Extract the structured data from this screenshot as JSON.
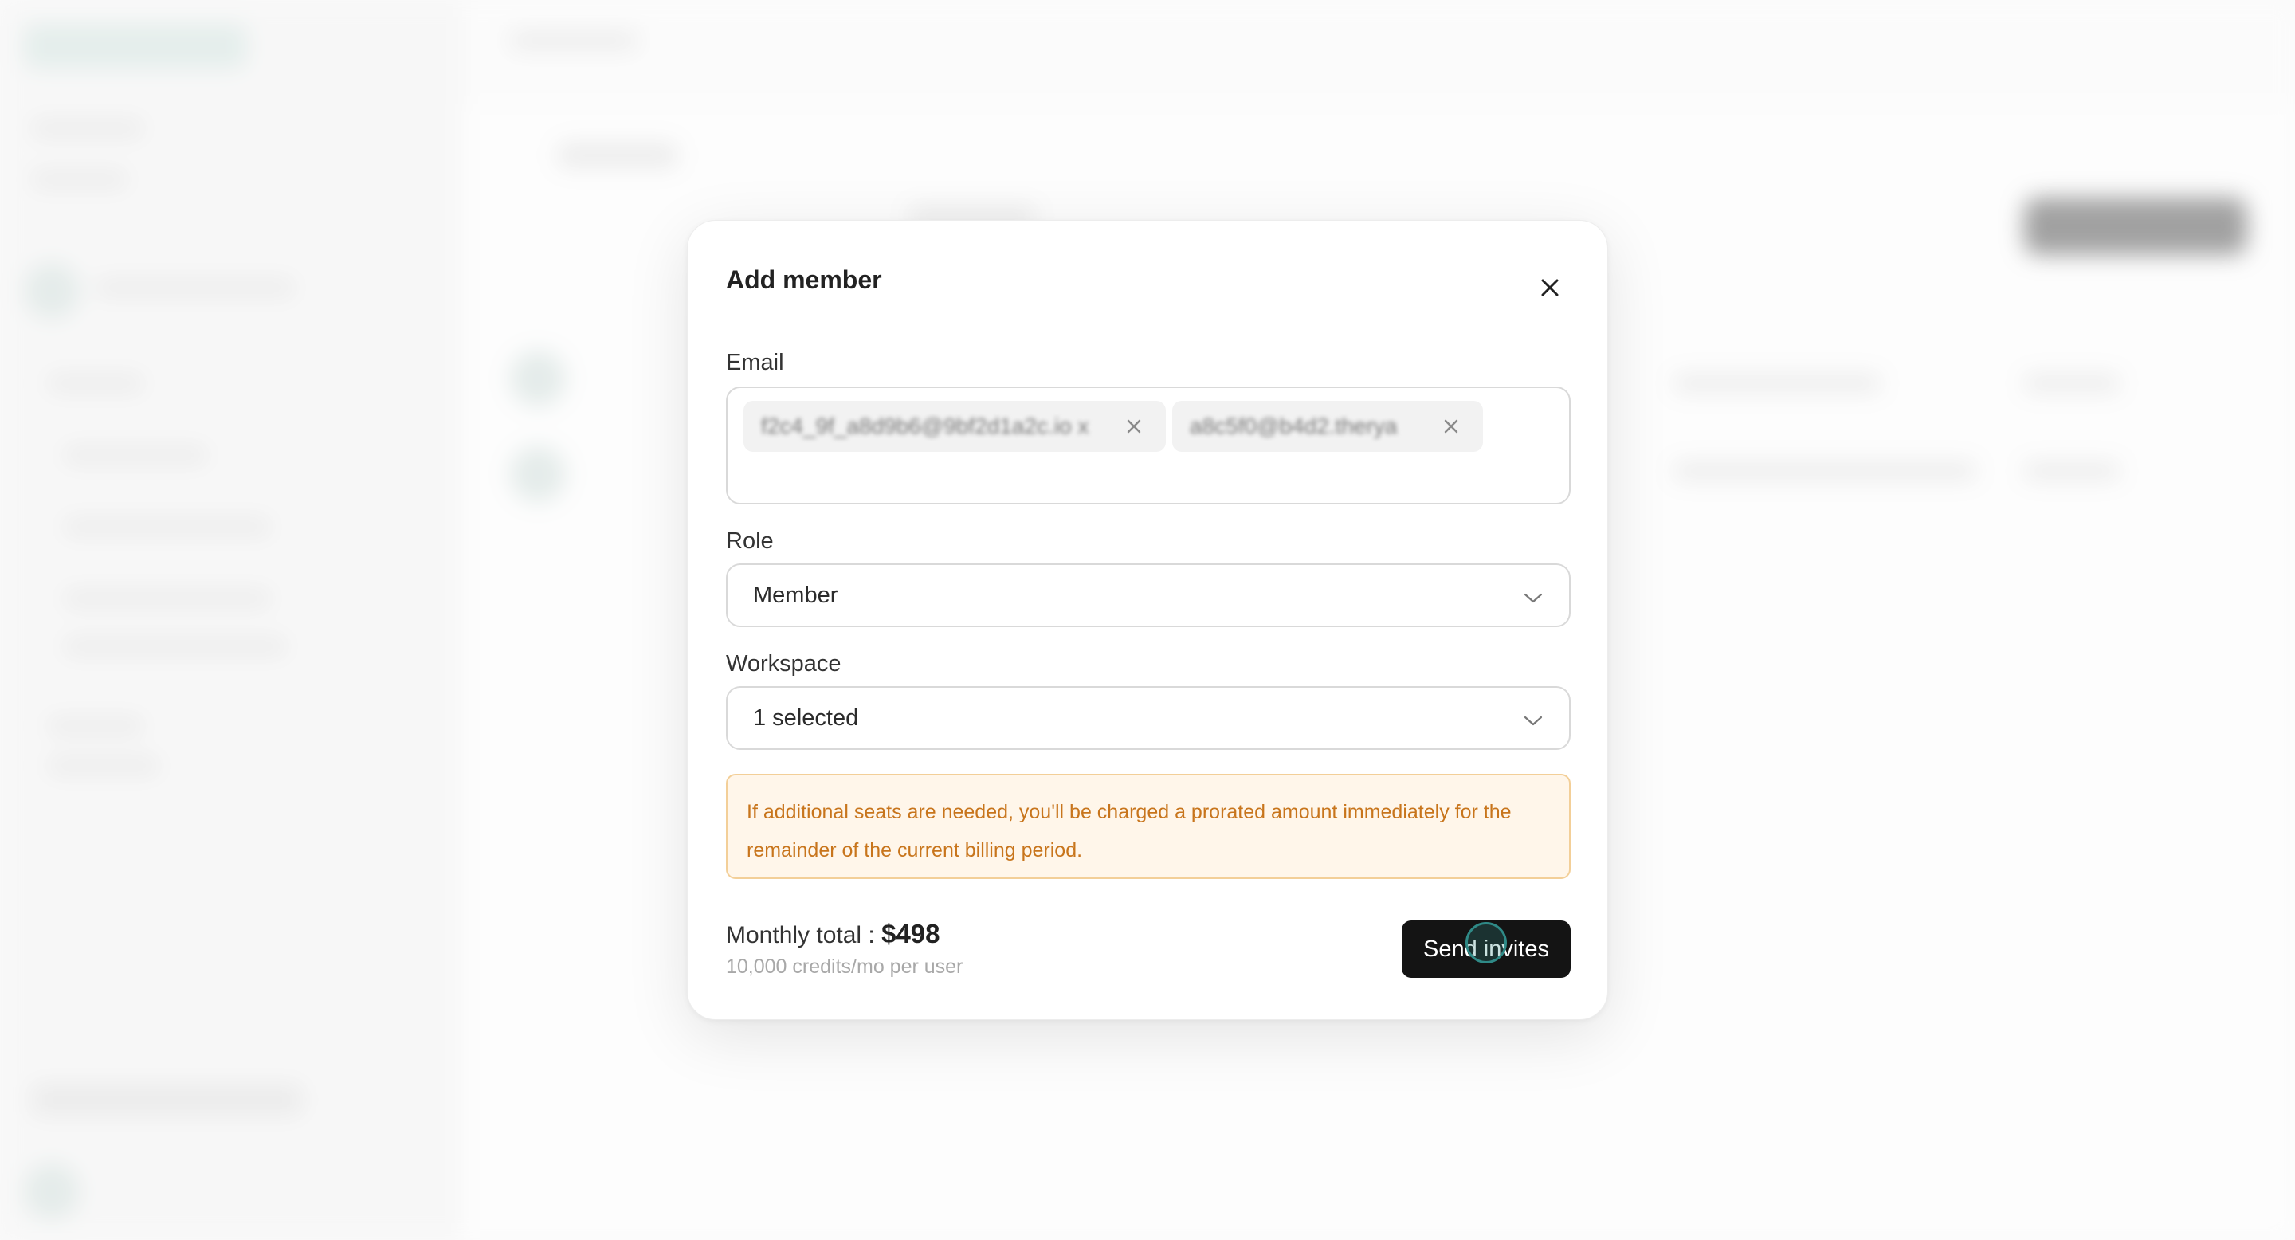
{
  "modal": {
    "title": "Add member",
    "close_icon": "close-icon"
  },
  "email": {
    "label": "Email",
    "chips": [
      {
        "text": "f2c4_9f_a8d9b6@9bf2d1a2c.io x",
        "remove_icon": "close-icon"
      },
      {
        "text": "a8c5f0@b4d2.therya",
        "remove_icon": "close-icon"
      }
    ]
  },
  "role": {
    "label": "Role",
    "value": "Member",
    "icon": "chevron-down-icon"
  },
  "workspace": {
    "label": "Workspace",
    "value": "1 selected",
    "icon": "chevron-down-icon"
  },
  "notice": {
    "text": "If additional seats are needed, you'll be charged a prorated amount immediately for the remainder of the current billing period."
  },
  "footer": {
    "total_label": "Monthly total : ",
    "total_amount": "$498",
    "credits": "10,000 credits/mo per user",
    "send_label": "Send invites"
  },
  "colors": {
    "notice_bg": "#fff6ea",
    "notice_border": "#f3cf98",
    "notice_text": "#c8751c",
    "primary_button": "#141414"
  }
}
